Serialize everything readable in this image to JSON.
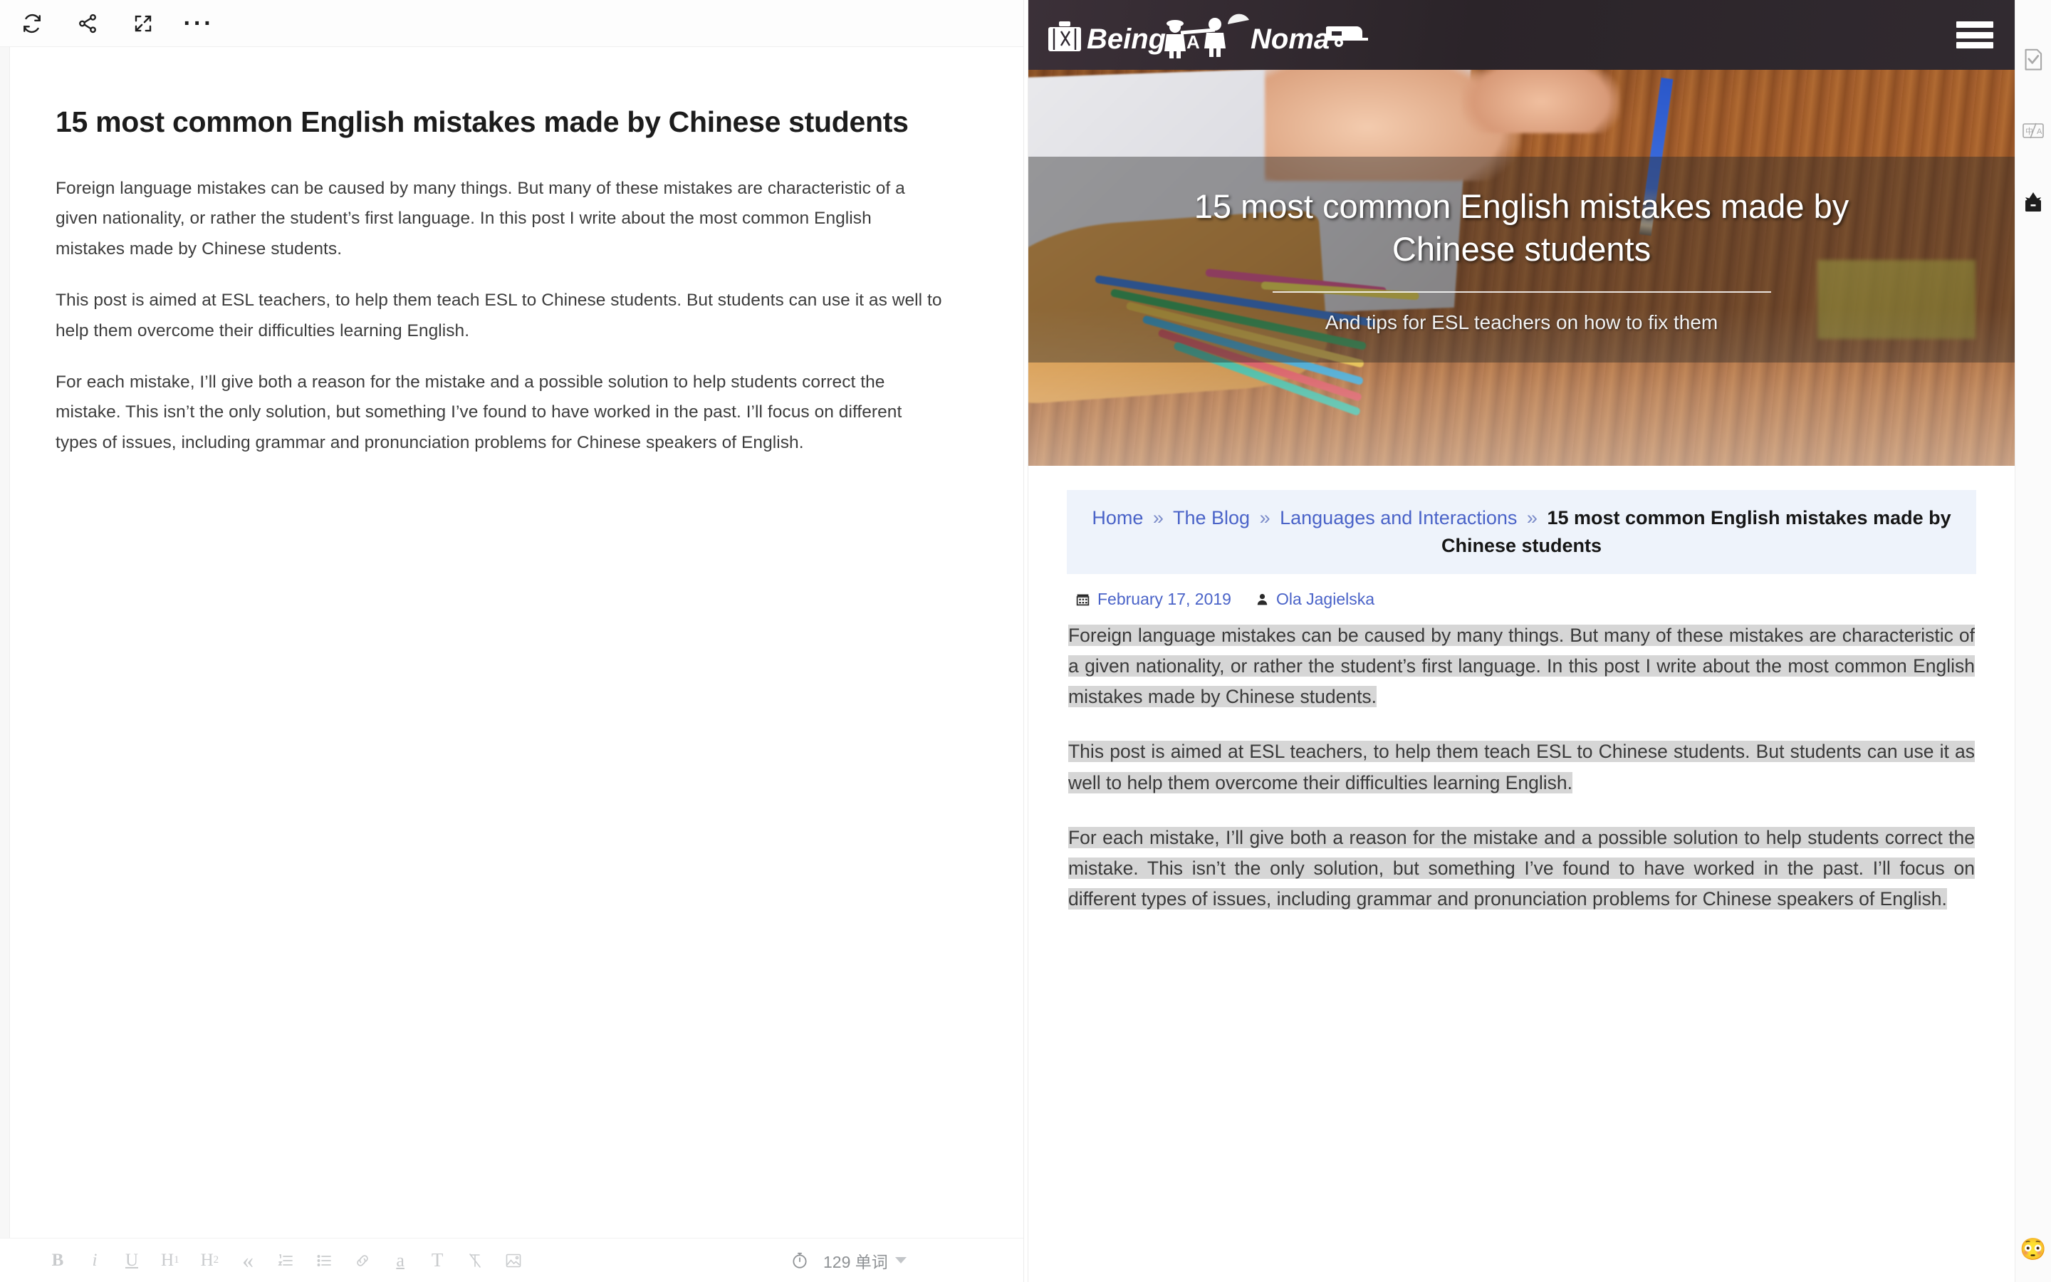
{
  "editor": {
    "toolbar": {
      "sync_label": "sync",
      "share_label": "share",
      "fullscreen_label": "fullscreen",
      "more_label": "···"
    },
    "document": {
      "title": "15 most common English mistakes made by Chinese students",
      "paragraphs": [
        "Foreign language mistakes can be caused by many things. But many of these mistakes are characteristic of a given nationality, or rather the student’s first language. In this post I write about the most common English mistakes made by Chinese students.",
        "This post is aimed at ESL teachers, to help them teach ESL to Chinese students. But students can use it as well to help them overcome their difficulties learning English.",
        "For each mistake, I’ll give both a reason for the mistake and a possible solution to help students correct the mistake. This isn’t the only solution, but something I’ve found to have worked in the past. I’ll focus on different types of issues, including grammar and pronunciation problems for Chinese speakers of English."
      ]
    },
    "format_bar": {
      "bold": "B",
      "italic": "i",
      "underline": "U",
      "heading1": "H",
      "heading1_sub": "1",
      "heading2": "H",
      "heading2_sub": "2",
      "quote": "“",
      "ordered_list": "ordered-list",
      "bullet_list": "bullet-list",
      "link": "link",
      "highlight": "a",
      "text_style": "T",
      "clear_format": "clear-format",
      "image": "image"
    },
    "status": {
      "word_count": "129 单词",
      "timer_icon": "timer-icon"
    }
  },
  "preview": {
    "site": {
      "logo_text": "Being A Nomad",
      "logo_word1": "Being",
      "logo_word2": "A",
      "logo_word3": "Nomad",
      "menu_label": "menu",
      "header_bg": "#2e2830"
    },
    "hero": {
      "title": "15 most common English mistakes made by Chinese students",
      "subtitle": "And tips for ESL teachers on how to fix them"
    },
    "breadcrumb": {
      "items": [
        {
          "label": "Home",
          "link": true
        },
        {
          "label": "The Blog",
          "link": true
        },
        {
          "label": "Languages and Interactions",
          "link": true
        }
      ],
      "separator": "»",
      "current": "15 most common English mistakes made by Chinese students",
      "bg": "#eef3fb",
      "link_color": "#4a63c8"
    },
    "meta": {
      "calendar_icon": "calendar-icon",
      "date": "February 17, 2019",
      "author_icon": "user-icon",
      "author": "Ola Jagielska"
    },
    "article": {
      "paragraphs": [
        "Foreign language mistakes can be caused by many things. But many of these mistakes are characteristic of a given nationality, or rather the student’s first language. In this post I write about the most common English mistakes made by Chinese students.",
        "This post is aimed at ESL teachers, to help them teach ESL to Chinese students. But students can use it as well to help them overcome their difficulties learning English.",
        "For each mistake, I’ll give both a reason for the mistake and a possible solution to help students correct the mistake. This isn’t the only solution, but something I’ve found to have worked in the past. I’ll focus on different types of issues, including grammar and pronunciation problems for Chinese speakers of English."
      ],
      "selection_color": "#d6d6d6"
    }
  },
  "rail": {
    "items": [
      {
        "name": "check-document-icon"
      },
      {
        "name": "translate-icon"
      },
      {
        "name": "archive-box-icon"
      }
    ],
    "emoji": "😳"
  }
}
